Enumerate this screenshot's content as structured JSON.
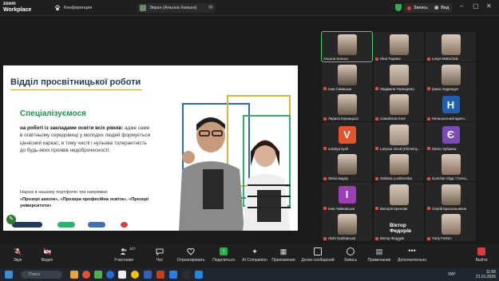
{
  "app": {
    "brand_line1": "zoom",
    "brand_line2": "Workplace"
  },
  "tabs": [
    {
      "label": "Конференция"
    },
    {
      "label": "Экран (Альона Хилько)"
    }
  ],
  "header": {
    "record_label": "Запись",
    "view_label": "Вид"
  },
  "slide": {
    "title": "Відділ просвітницької роботи",
    "subtitle": "Спеціалізуємося",
    "desc_bold": "на роботі із закладами освіти всіх рівнів:",
    "desc_rest": " адже саме в освітньому середовищі у молодих людей формується ціннісний каркас, в тому числі і нульова толерантність до будь-яких проявів недоброчесності.",
    "portfolio_intro": "Наразі в нашому портфоліо три напрямки:",
    "portfolio_lines": "«Прозорі школи», «Прозора професійна освіта», «Прозорі університети»",
    "bar_colors": [
      "#1e3a56",
      "#2bb36a",
      "#3d6fb5",
      "#e03b3b"
    ]
  },
  "participants": [
    {
      "name": "Альона Хилько",
      "muted": false
    },
    {
      "name": "Ніна Тюрина",
      "muted": true
    },
    {
      "name": "Lesya Matvichuk",
      "muted": true
    },
    {
      "name": "Інна Савицька",
      "muted": true
    },
    {
      "name": "Людмила Терещенко",
      "muted": true
    },
    {
      "name": "Ірина Андрощук",
      "muted": true
    },
    {
      "name": "Лариса Корницька",
      "muted": true
    },
    {
      "name": "Самойлов Олег",
      "muted": true
    },
    {
      "name": "Начально-методичн...",
      "muted": true,
      "initial": "Н",
      "color": "#1f5fae"
    },
    {
      "name": "volodya kysil",
      "muted": true,
      "initial": "V",
      "color": "#e5532d"
    },
    {
      "name": "Laryssa Ovod (Khmelny...",
      "muted": true
    },
    {
      "name": "Євген Урбанюк",
      "muted": true,
      "initial": "Є",
      "color": "#7c4bb8"
    },
    {
      "name": "Olena Bagriy",
      "muted": true
    },
    {
      "name": "Svitlana Luchkovska",
      "muted": true
    },
    {
      "name": "Gonchar Olga / Гонча...",
      "muted": true
    },
    {
      "name": "Інна Чайковська",
      "muted": true,
      "initial": "І",
      "color": "#9b3fb5"
    },
    {
      "name": "Вікторія Кренова",
      "muted": true
    },
    {
      "name": "Сергій Красильников",
      "muted": true
    },
    {
      "name": "Лілія Грабовська",
      "muted": true
    },
    {
      "name": "Віктор Федорів",
      "muted": true,
      "big": "Віктор Федорів"
    },
    {
      "name": "Yuriy Forkun",
      "muted": true
    }
  ],
  "toolbar": [
    {
      "label": "Звук"
    },
    {
      "label": "Видео"
    },
    {
      "label": "Участники",
      "count": "107"
    },
    {
      "label": "Чат"
    },
    {
      "label": "Отреагировать"
    },
    {
      "label": "Поделиться"
    },
    {
      "label": "AI Companion"
    },
    {
      "label": "Приложения"
    },
    {
      "label": "Доски сообщений"
    },
    {
      "label": "Запись"
    },
    {
      "label": "Примечание"
    },
    {
      "label": "Дополнительно"
    },
    {
      "label": "Выйти"
    }
  ],
  "taskbar": {
    "search_placeholder": "Поиск",
    "time": "11:56",
    "date": "21.01.2026",
    "lang": "УКР"
  }
}
